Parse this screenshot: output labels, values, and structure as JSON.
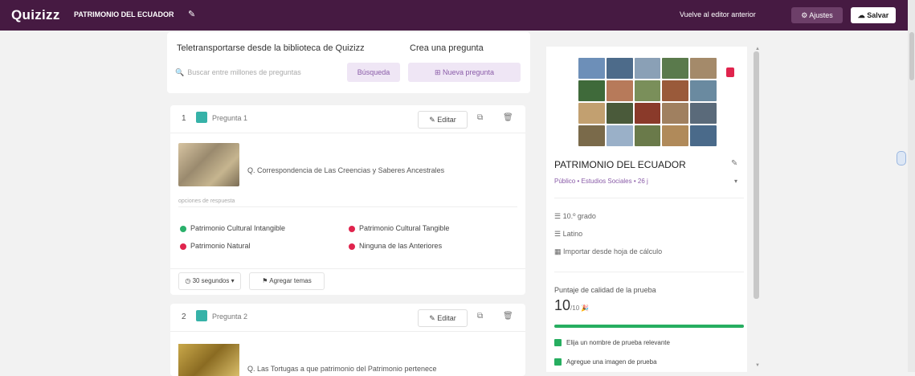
{
  "topbar": {
    "logo": "Quizizz",
    "quiz_title": "PATRIMONIO DEL ECUADOR",
    "edit_icon": "pencil-icon",
    "old_editor": "Vuelve al editor anterior",
    "settings_label": "Ajustes",
    "settings_icon": "gear-icon",
    "exit_label": "Salvar",
    "exit_icon": "cloud-save-icon"
  },
  "import": {
    "teleport_heading": "Teletransportarse desde la biblioteca de Quizizz",
    "create_heading": "Crea una pregunta",
    "search_placeholder": "Buscar entre millones de preguntas",
    "search_button": "Búsqueda",
    "new_question_button": "Nueva pregunta"
  },
  "questions": [
    {
      "number": "1",
      "label": "Pregunta 1",
      "edit_label": "Editar",
      "text": "Q. Correspondencia de Las Creencias y Saberes Ancestrales",
      "answers_label": "opciones de respuesta",
      "options": [
        {
          "text": "Patrimonio Cultural Intangible",
          "correct": true
        },
        {
          "text": "Patrimonio Cultural Tangible",
          "correct": false
        },
        {
          "text": "Patrimonio Natural",
          "correct": false
        },
        {
          "text": "Ninguna de las Anteriores",
          "correct": false
        }
      ],
      "time_label": "30 segundos",
      "tags_label": "Agregar temas"
    },
    {
      "number": "2",
      "label": "Pregunta 2",
      "edit_label": "Editar",
      "text": "Q. Las Tortugas a que patrimonio del Patrimonio pertenece"
    }
  ],
  "sidebar": {
    "title": "PATRIMONIO DEL ECUADOR",
    "meta": "Público • Estudios Sociales • 26 j",
    "grade": "10.º grado",
    "language": "Latino",
    "import_sheet": "Importar desde hoja de cálculo",
    "score_title": "Puntaje de calidad de la prueba",
    "score_value": "10",
    "score_max": "/10",
    "score_fraction": 1.0,
    "checks": [
      "Elija un nombre de prueba relevante",
      "Agregue una imagen de prueba"
    ]
  },
  "colors": {
    "brand": "#461a42",
    "correct": "#2ab06b",
    "incorrect": "#e0244d",
    "accent": "#8a5ca8"
  }
}
